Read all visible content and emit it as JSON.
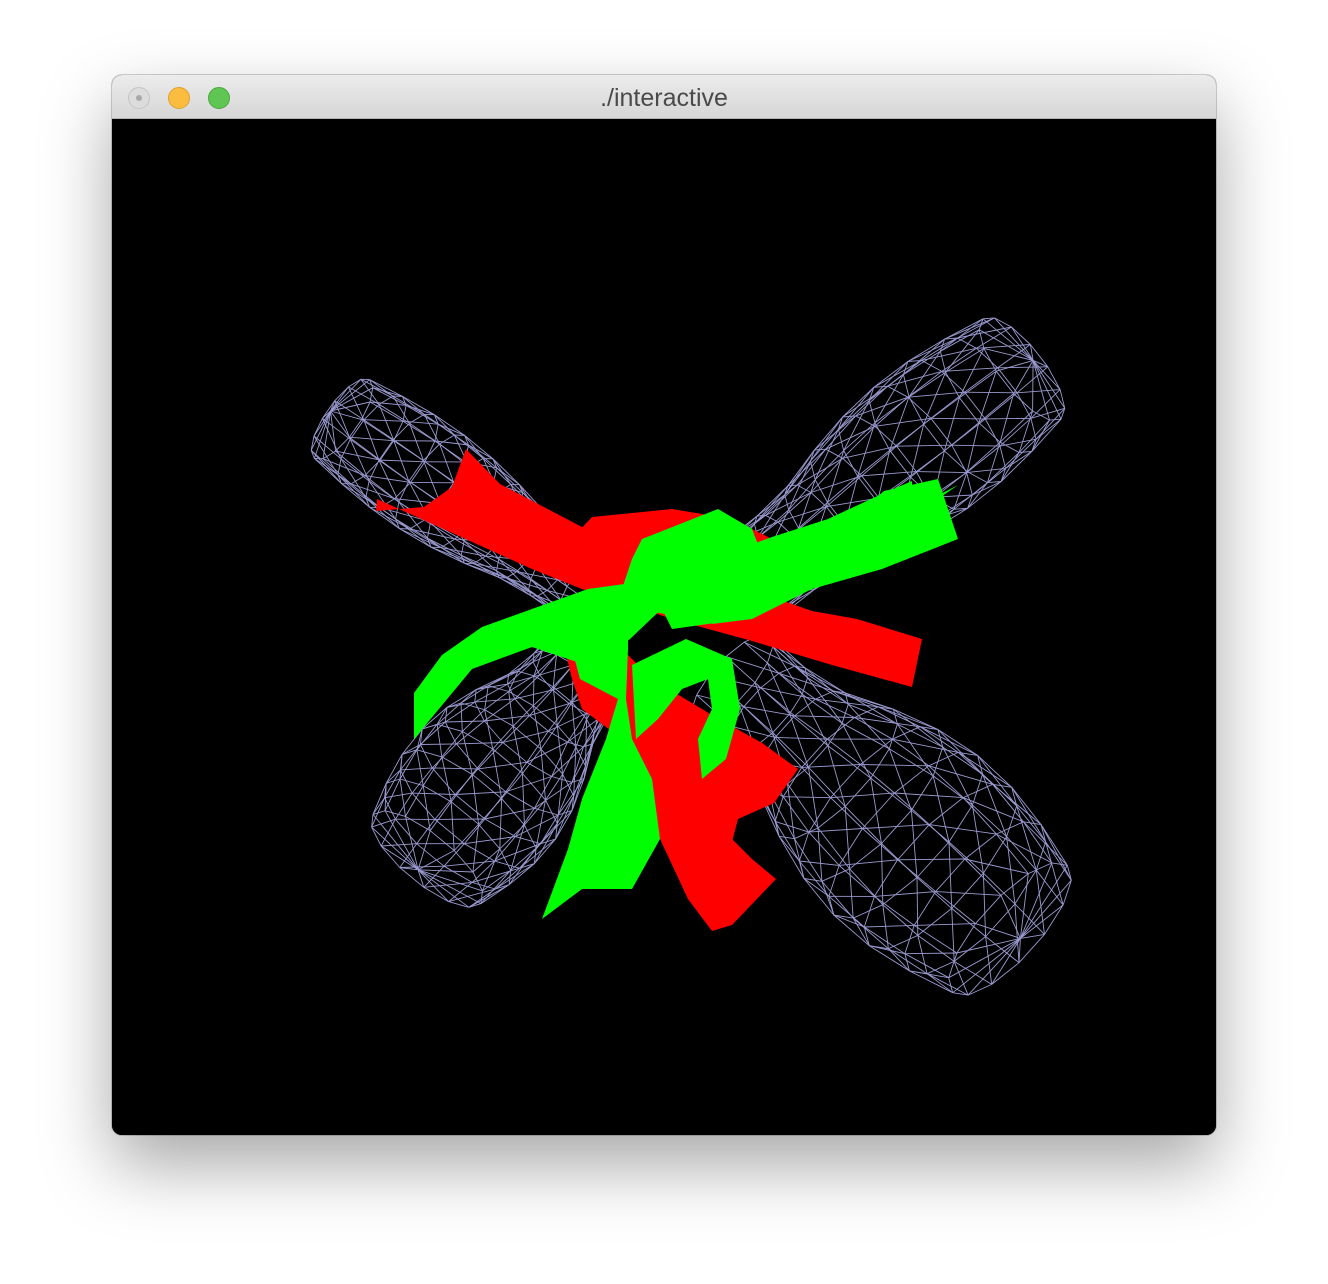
{
  "window": {
    "title": "./interactive"
  },
  "traffic_lights": {
    "close": {
      "icon": "close-icon",
      "color": "#dcdcdc"
    },
    "minimize": {
      "icon": "minimize-icon",
      "color": "#fcbc40"
    },
    "zoom": {
      "icon": "zoom-icon",
      "color": "#5fc553"
    }
  },
  "scene": {
    "background": "#000000",
    "mesh_color": "#9a9ad0",
    "ribbon_colors": [
      "#ff0000",
      "#00ff00"
    ],
    "meshes": [
      "upper-left-lobe",
      "upper-right-lobe",
      "lower-left-lobe",
      "lower-right-lobe"
    ]
  }
}
